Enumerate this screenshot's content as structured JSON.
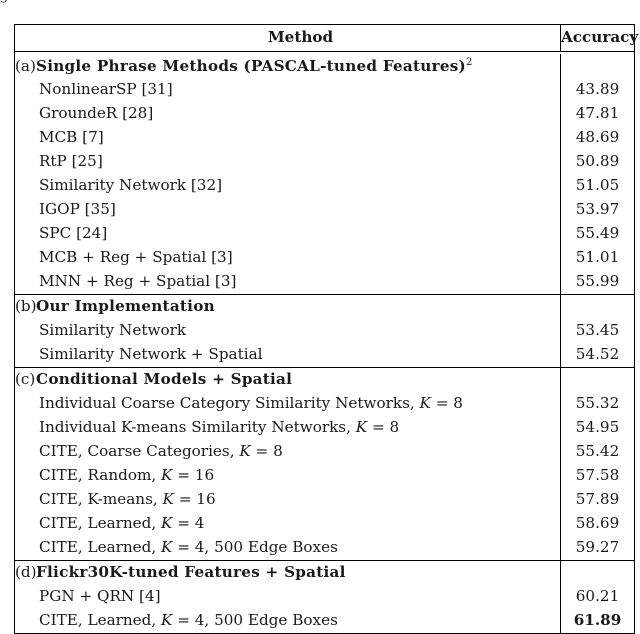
{
  "caption_fragment": "g",
  "table": {
    "columns": [
      "Method",
      "Accuracy"
    ],
    "groups": [
      {
        "tag": "(a)",
        "title": "Single Phrase Methods (PASCAL-tuned Features)",
        "title_superscript": "2",
        "title_accuracy": "",
        "rows": [
          {
            "label": "NonlinearSP [31]",
            "accuracy": "43.89",
            "bold": false
          },
          {
            "label": "GroundeR [28]",
            "accuracy": "47.81",
            "bold": false
          },
          {
            "label": "MCB [7]",
            "accuracy": "48.69",
            "bold": false
          },
          {
            "label": "RtP [25]",
            "accuracy": "50.89",
            "bold": false
          },
          {
            "label": "Similarity Network [32]",
            "accuracy": "51.05",
            "bold": false
          },
          {
            "label": "IGOP [35]",
            "accuracy": "53.97",
            "bold": false
          },
          {
            "label": "SPC [24]",
            "accuracy": "55.49",
            "bold": false
          },
          {
            "label": "MCB + Reg + Spatial [3]",
            "accuracy": "51.01",
            "bold": false
          },
          {
            "label": "MNN + Reg + Spatial [3]",
            "accuracy": "55.99",
            "bold": false
          }
        ]
      },
      {
        "tag": "(b)",
        "title": "Our Implementation",
        "title_superscript": "",
        "title_accuracy": "",
        "rows": [
          {
            "label": "Similarity Network",
            "accuracy": "53.45",
            "bold": false
          },
          {
            "label": "Similarity Network + Spatial",
            "accuracy": "54.52",
            "bold": false
          }
        ]
      },
      {
        "tag": "(c)",
        "title": "Conditional Models + Spatial",
        "title_superscript": "",
        "title_accuracy": "",
        "rows": [
          {
            "label": "Individual Coarse Category Similarity Networks, <i>K</i> = 8",
            "accuracy": "55.32",
            "bold": false
          },
          {
            "label": "Individual K-means Similarity Networks, <i>K</i> = 8",
            "accuracy": "54.95",
            "bold": false
          },
          {
            "label": "CITE, Coarse Categories, <i>K</i> = 8",
            "accuracy": "55.42",
            "bold": false
          },
          {
            "label": "CITE, Random, <i>K</i> = 16",
            "accuracy": "57.58",
            "bold": false
          },
          {
            "label": "CITE, K-means, <i>K</i> = 16",
            "accuracy": "57.89",
            "bold": false
          },
          {
            "label": "CITE, Learned, <i>K</i> = 4",
            "accuracy": "58.69",
            "bold": false
          },
          {
            "label": "CITE, Learned, <i>K</i> = 4, 500 Edge Boxes",
            "accuracy": "59.27",
            "bold": false
          }
        ]
      },
      {
        "tag": "(d)",
        "title": "Flickr30K-tuned Features + Spatial",
        "title_superscript": "",
        "title_accuracy": "",
        "rows": [
          {
            "label": "PGN + QRN [4]",
            "accuracy": "60.21",
            "bold": false
          },
          {
            "label": "CITE, Learned, <i>K</i> = 4, 500 Edge Boxes",
            "accuracy": "61.89",
            "bold": true
          }
        ]
      }
    ]
  }
}
